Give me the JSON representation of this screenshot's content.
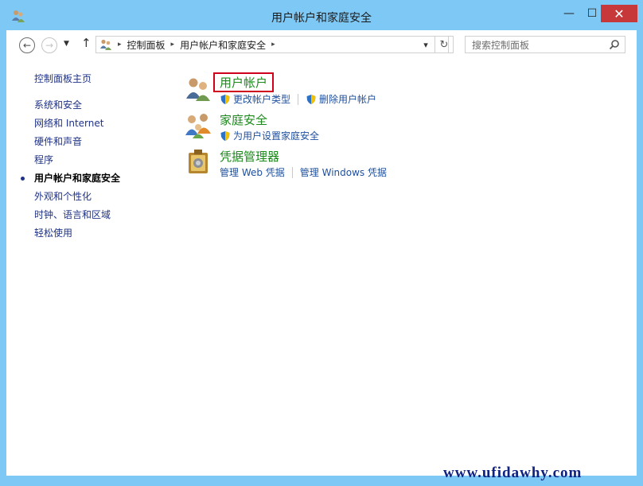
{
  "window": {
    "title": "用户帐户和家庭安全",
    "minimize_glyph": "—",
    "maximize_glyph": "☐",
    "close_glyph": "✕",
    "close_color": "#c7383a",
    "frame_color": "#7ec8f5"
  },
  "toolbar": {
    "back_glyph": "←",
    "forward_glyph": "→",
    "recent_glyph": "▼",
    "up_glyph": "↑",
    "breadcrumbs": [
      "控制面板",
      "用户帐户和家庭安全"
    ],
    "crumb_sep": "▸",
    "dropdown_glyph": "▾",
    "refresh_glyph": "↻",
    "search_placeholder": "搜索控制面板"
  },
  "sidebar": {
    "home": "控制面板主页",
    "items": [
      {
        "label": "系统和安全"
      },
      {
        "label": "网络和 Internet"
      },
      {
        "label": "硬件和声音"
      },
      {
        "label": "程序"
      },
      {
        "label": "用户帐户和家庭安全",
        "current": true
      },
      {
        "label": "外观和个性化"
      },
      {
        "label": "时钟、语言和区域"
      },
      {
        "label": "轻松使用"
      }
    ]
  },
  "categories": [
    {
      "title": "用户帐户",
      "icon": "user-accounts-icon",
      "highlighted": true,
      "links": [
        {
          "label": "更改帐户类型",
          "shield": true
        },
        {
          "label": "删除用户帐户",
          "shield": true
        }
      ]
    },
    {
      "title": "家庭安全",
      "icon": "family-safety-icon",
      "links": [
        {
          "label": "为用户设置家庭安全",
          "shield": true
        }
      ]
    },
    {
      "title": "凭据管理器",
      "icon": "credential-manager-icon",
      "links": [
        {
          "label": "管理 Web 凭据",
          "shield": false
        },
        {
          "label": "管理 Windows 凭据",
          "shield": false
        }
      ]
    }
  ],
  "watermark": "www.ufidawhy.com",
  "colors": {
    "link": "#1e4f9e",
    "category_title": "#1b8a1b",
    "nav_link": "#1e3287",
    "highlight_border": "#d0021b"
  }
}
